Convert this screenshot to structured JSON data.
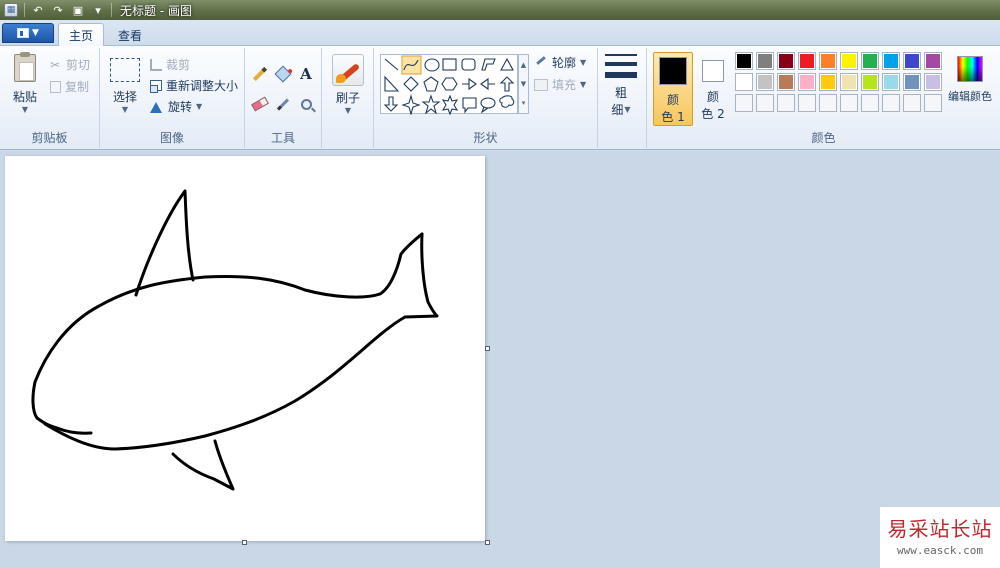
{
  "window": {
    "title": "无标题 - 画图"
  },
  "tabs": [
    {
      "label": "主页"
    },
    {
      "label": "查看"
    }
  ],
  "groups": {
    "clipboard": {
      "label": "剪贴板",
      "paste": "粘贴",
      "cut": "剪切",
      "copy": "复制"
    },
    "image": {
      "label": "图像",
      "select": "选择",
      "crop": "裁剪",
      "resize": "重新调整大小",
      "rotate": "旋转"
    },
    "tools": {
      "label": "工具",
      "text_glyph": "A"
    },
    "brushes": {
      "label": "刷子"
    },
    "shapes": {
      "label": "形状",
      "outline": "轮廓",
      "fill": "填充"
    },
    "size": {
      "label_line1": "粗",
      "label_line2": "细"
    },
    "colors": {
      "label": "颜色",
      "color1_line1": "颜",
      "color1_line2": "色 1",
      "color2_line1": "颜",
      "color2_line2": "色 2",
      "color1_value": "#000000",
      "color2_value": "#ffffff",
      "edit": "编辑颜色",
      "palette_row1": [
        "#000000",
        "#7f7f7f",
        "#880015",
        "#ed1c24",
        "#ff7f27",
        "#fff200",
        "#22b14c",
        "#00a2e8",
        "#3f48cc",
        "#a349a4"
      ],
      "palette_row2": [
        "#ffffff",
        "#c3c3c3",
        "#b97a57",
        "#ffaec9",
        "#ffc90e",
        "#efe4b0",
        "#b5e61d",
        "#99d9ea",
        "#7092be",
        "#c8bfe7"
      ],
      "palette_row3": [
        "",
        "",
        "",
        "",
        "",
        "",
        "",
        "",
        "",
        ""
      ]
    }
  },
  "watermark": {
    "title": "易采站长站",
    "url": "www.easck.com"
  }
}
